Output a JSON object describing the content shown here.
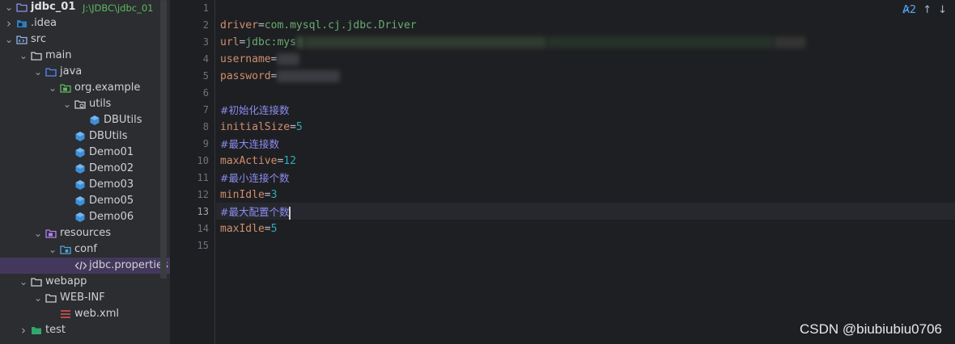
{
  "project": {
    "name": "jdbc_01",
    "path": "J:\\JDBC\\jdbc_01"
  },
  "tree": [
    {
      "label": "jdbc_01",
      "path": "J:\\JDBC\\jdbc_01",
      "depth": 0,
      "expanded": true,
      "icon": "module-folder-icon"
    },
    {
      "label": ".idea",
      "depth": 0,
      "expanded": false,
      "icon": "idea-folder-icon"
    },
    {
      "label": "src",
      "depth": 0,
      "expanded": true,
      "icon": "source-folder-icon"
    },
    {
      "label": "main",
      "depth": 1,
      "expanded": true,
      "icon": "folder-icon"
    },
    {
      "label": "java",
      "depth": 2,
      "expanded": true,
      "icon": "source-root-icon"
    },
    {
      "label": "org.example",
      "depth": 3,
      "expanded": true,
      "icon": "package-icon"
    },
    {
      "label": "utils",
      "depth": 4,
      "expanded": true,
      "icon": "package-outline-icon"
    },
    {
      "label": "DBUtils",
      "depth": 5,
      "icon": "class-icon"
    },
    {
      "label": "DBUtils",
      "depth": 4,
      "icon": "class-icon"
    },
    {
      "label": "Demo01",
      "depth": 4,
      "icon": "class-icon"
    },
    {
      "label": "Demo02",
      "depth": 4,
      "icon": "class-icon"
    },
    {
      "label": "Demo03",
      "depth": 4,
      "icon": "class-icon"
    },
    {
      "label": "Demo05",
      "depth": 4,
      "icon": "class-icon"
    },
    {
      "label": "Demo06",
      "depth": 4,
      "icon": "class-icon"
    },
    {
      "label": "resources",
      "depth": 2,
      "expanded": true,
      "icon": "resources-folder-icon"
    },
    {
      "label": "conf",
      "depth": 3,
      "expanded": true,
      "icon": "config-folder-icon"
    },
    {
      "label": "jdbc.properties",
      "depth": 4,
      "icon": "properties-file-icon",
      "selected": true
    },
    {
      "label": "webapp",
      "depth": 1,
      "expanded": true,
      "icon": "folder-icon"
    },
    {
      "label": "WEB-INF",
      "depth": 2,
      "expanded": true,
      "icon": "folder-icon"
    },
    {
      "label": "web.xml",
      "depth": 3,
      "icon": "xml-file-icon"
    },
    {
      "label": "test",
      "depth": 1,
      "expanded": false,
      "icon": "test-folder-icon"
    }
  ],
  "editor": {
    "inspection_count": "2",
    "current_line": 13,
    "lines": [
      {
        "n": "1",
        "text": ""
      },
      {
        "n": "2",
        "key": "driver",
        "value": "com.mysql.cj.jdbc.Driver"
      },
      {
        "n": "3",
        "key": "url",
        "value": "jdbc:mys",
        "redacted": true
      },
      {
        "n": "4",
        "key": "username",
        "value": "",
        "redacted": true
      },
      {
        "n": "5",
        "key": "password",
        "value": "",
        "redacted": true
      },
      {
        "n": "6",
        "text": ""
      },
      {
        "n": "7",
        "comment": "#初始化连接数"
      },
      {
        "n": "8",
        "key": "initialSize",
        "value": "5"
      },
      {
        "n": "9",
        "comment": "#最大连接数"
      },
      {
        "n": "10",
        "key": "maxActive",
        "value": "12"
      },
      {
        "n": "11",
        "comment": "#最小连接个数"
      },
      {
        "n": "12",
        "key": "minIdle",
        "value": "3"
      },
      {
        "n": "13",
        "comment": "#最大配置个数"
      },
      {
        "n": "14",
        "key": "maxIdle",
        "value": "5"
      },
      {
        "n": "15",
        "text": ""
      }
    ]
  },
  "watermark": "CSDN @biubiubiu0706",
  "colors": {
    "key": "#cf8e6d",
    "number": "#2aacb8",
    "string": "#6aab73",
    "comment": "#8c8cf0",
    "selection": "#43385c"
  }
}
